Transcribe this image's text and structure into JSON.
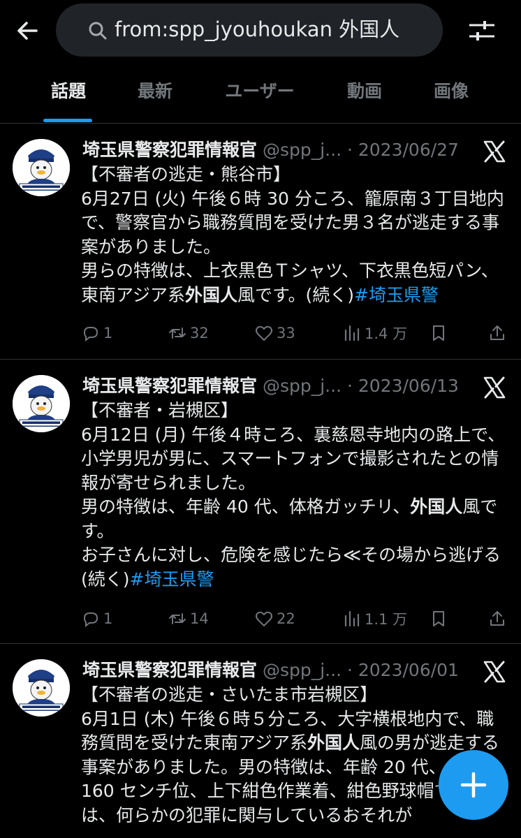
{
  "search": {
    "query": "from:spp_jyouhoukan 外国人"
  },
  "tabs": [
    {
      "label": "話題"
    },
    {
      "label": "最新"
    },
    {
      "label": "ユーザー"
    },
    {
      "label": "動画"
    },
    {
      "label": "画像"
    }
  ],
  "tweets": [
    {
      "name": "埼玉県警察犯罪情報官",
      "handle": "@spp_j...",
      "sep": " · ",
      "date": "2023/06/27",
      "body_before": "【不審者の逃走・熊谷市】\n6月27日 (火) 午後６時 30 分ころ、籠原南３丁目地内で、警察官から職務質問を受けた男３名が逃走する事案がありました。\n男らの特徴は、上衣黒色Ｔシャツ、下衣黒色短パン、東南アジア系",
      "body_bold": "外国人",
      "body_after": "風です。(続く)",
      "hashtag": "#埼玉県警",
      "replies": "1",
      "retweets": "32",
      "likes": "33",
      "views": "1.4 万"
    },
    {
      "name": "埼玉県警察犯罪情報官",
      "handle": "@spp_j...",
      "sep": " · ",
      "date": "2023/06/13",
      "body_before": "【不審者・岩槻区】\n6月12日 (月) 午後４時ころ、裏慈恩寺地内の路上で、小学男児が男に、スマートフォンで撮影されたとの情報が寄せられました。\n男の特徴は、年齢 40 代、体格ガッチリ、",
      "body_bold": "外国人",
      "body_after": "風です。\nお子さんに対し、危険を感じたら≪その場から逃げる (続く)",
      "hashtag": "#埼玉県警",
      "replies": "1",
      "retweets": "14",
      "likes": "22",
      "views": "1.1 万"
    },
    {
      "name": "埼玉県警察犯罪情報官",
      "handle": "@spp_j...",
      "sep": " · ",
      "date": "2023/06/01",
      "body_before": "【不審者の逃走・さいたま市岩槻区】\n6月1日 (木) 午後６時５分ころ、大字横根地内で、職務質問を受けた東南アジア系",
      "body_bold": "外国人",
      "body_after": "風の男が逃走する事案がありました。男の特徴は、年齢 20 代、身長 160 センチ位、上下紺色作業着、紺色野球帽です。男は、何らかの犯罪に関与しているおそれが",
      "hashtag": "",
      "replies": "",
      "retweets": "",
      "likes": "",
      "views": ""
    }
  ],
  "colors": {
    "accent": "#1d9bf0",
    "muted": "#71767b",
    "text": "#e7e9ea",
    "background": "#000000"
  },
  "icons": [
    "back-arrow-icon",
    "search-icon",
    "filter-sliders-icon",
    "x-logo-icon",
    "reply-icon",
    "retweet-icon",
    "like-icon",
    "views-icon",
    "bookmark-icon",
    "share-icon",
    "compose-plus-icon"
  ]
}
